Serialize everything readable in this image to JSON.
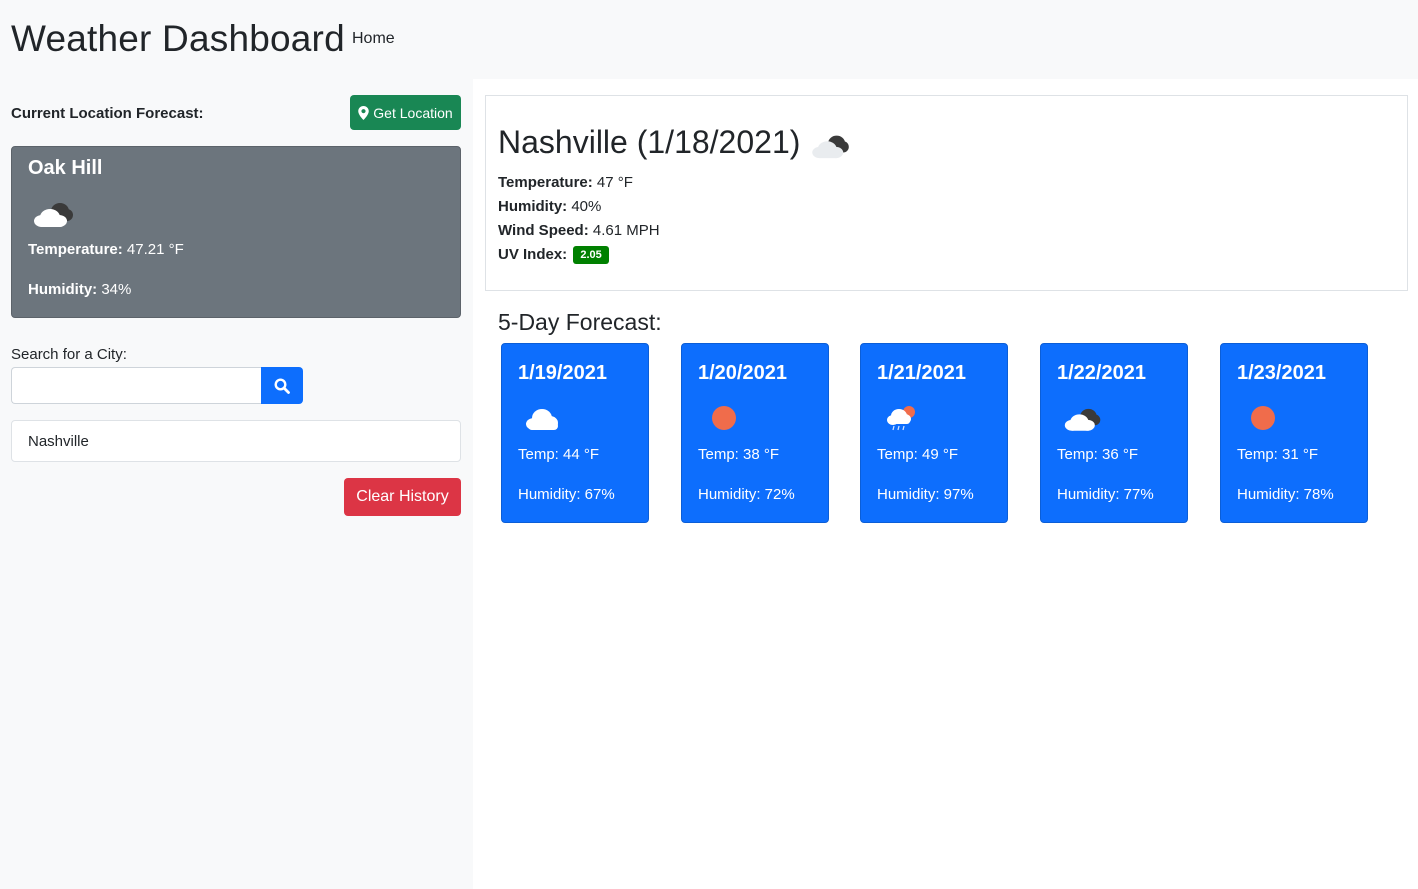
{
  "header": {
    "brand": "Weather Dashboard",
    "nav_home": "Home"
  },
  "sidebar": {
    "location_label": "Current Location Forecast:",
    "get_location_label": "Get Location",
    "current": {
      "city": "Oak Hill",
      "icon": "cloud-icon",
      "temperature_label": "Temperature:",
      "temperature_value": "47.21 °F",
      "humidity_label": "Humidity:",
      "humidity_value": "34%"
    },
    "search_label": "Search for a City:",
    "search_value": "",
    "history": [
      "Nashville"
    ],
    "clear_history_label": "Clear History"
  },
  "today": {
    "title": "Nashville (1/18/2021)",
    "icon": "cloud-icon",
    "temperature_label": "Temperature:",
    "temperature_value": "47 °F",
    "humidity_label": "Humidity:",
    "humidity_value": "40%",
    "wind_label": "Wind Speed:",
    "wind_value": "4.61 MPH",
    "uv_label": "UV Index:",
    "uv_value": "2.05"
  },
  "forecast": {
    "title": "5-Day Forecast:",
    "days": [
      {
        "date": "1/19/2021",
        "icon": "cloud-icon",
        "temp": "Temp: 44 °F",
        "humidity": "Humidity: 67%"
      },
      {
        "date": "1/20/2021",
        "icon": "sun-icon",
        "temp": "Temp: 38 °F",
        "humidity": "Humidity: 72%"
      },
      {
        "date": "1/21/2021",
        "icon": "rain-sun-icon",
        "temp": "Temp: 49 °F",
        "humidity": "Humidity: 97%"
      },
      {
        "date": "1/22/2021",
        "icon": "cloud-icon",
        "temp": "Temp: 36 °F",
        "humidity": "Humidity: 77%"
      },
      {
        "date": "1/23/2021",
        "icon": "sun-icon",
        "temp": "Temp: 31 °F",
        "humidity": "Humidity: 78%"
      }
    ]
  },
  "colors": {
    "primary": "#0d6efd",
    "success": "#198754",
    "danger": "#dc3545",
    "secondary": "#6c757d",
    "uv_low": "#008000"
  }
}
